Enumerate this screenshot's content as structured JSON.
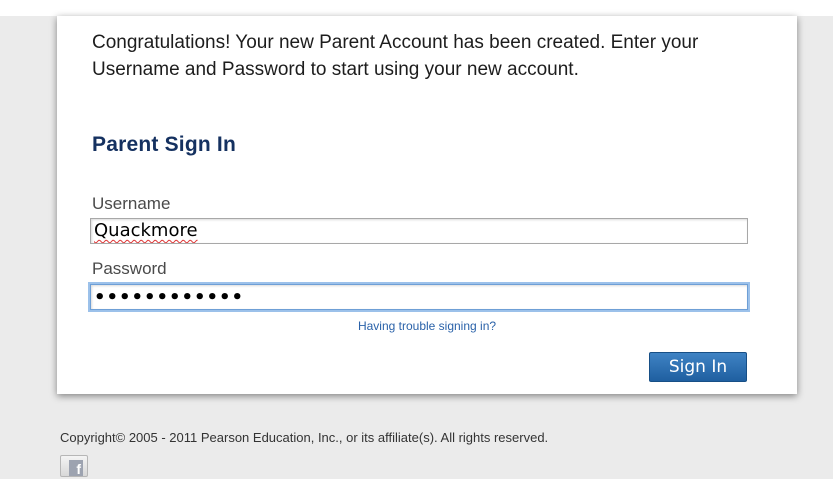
{
  "message": "Congratulations! Your new Parent Account has been created. Enter your Username and Password to start using your new account.",
  "signin": {
    "title": "Parent Sign In",
    "username_label": "Username",
    "username_value": "Quackmore",
    "password_label": "Password",
    "password_value": "••••••••••••",
    "trouble_link": "Having trouble signing in?",
    "button_label": "Sign In"
  },
  "footer": {
    "copyright": "Copyright© 2005 - 2011 Pearson Education, Inc., or its affiliate(s). All rights reserved.",
    "facebook_icon": "f"
  },
  "colors": {
    "title": "#153160",
    "link": "#2a62a9",
    "button": "#2a6eb0",
    "focus_ring": "#9cc1ea"
  }
}
